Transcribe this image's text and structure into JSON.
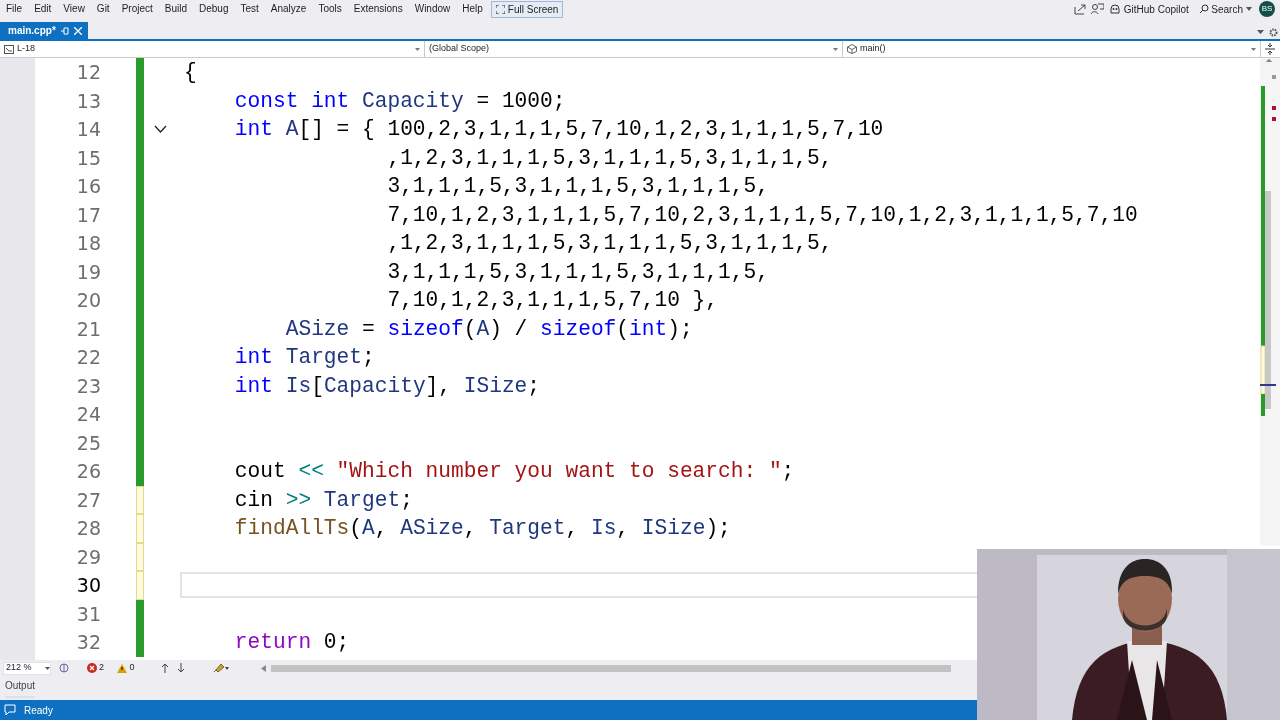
{
  "menu": [
    "File",
    "Edit",
    "View",
    "Git",
    "Project",
    "Build",
    "Debug",
    "Test",
    "Analyze",
    "Tools",
    "Extensions",
    "Window",
    "Help"
  ],
  "full_screen_button": "Full Screen",
  "copilot": "GitHub Copilot",
  "search": "Search",
  "avatar": "BS",
  "tabs": [
    {
      "label": "main.cpp*",
      "selected": true
    }
  ],
  "nav": {
    "project": "L-18",
    "scope": "(Global Scope)",
    "member": "main()"
  },
  "lines": [
    {
      "number": "12",
      "saved": true,
      "current": false,
      "fold": false,
      "tokens": [
        {
          "kind": "plain",
          "text": "{"
        }
      ]
    },
    {
      "number": "13",
      "saved": true,
      "current": false,
      "fold": false,
      "tokens": [
        {
          "kind": "kw",
          "text": "    const int "
        },
        {
          "kind": "var",
          "text": "Capacity"
        },
        {
          "kind": "plain",
          "text": " = 1000;"
        }
      ]
    },
    {
      "number": "14",
      "saved": true,
      "current": false,
      "fold": true,
      "tokens": [
        {
          "kind": "kw",
          "text": "    int "
        },
        {
          "kind": "var",
          "text": "A"
        },
        {
          "kind": "plain",
          "text": "[] = { 100,2,3,1,1,1,5,7,10,1,2,3,1,1,1,5,7,10"
        }
      ]
    },
    {
      "number": "15",
      "saved": true,
      "current": false,
      "fold": false,
      "tokens": [
        {
          "kind": "plain",
          "text": "                ,1,2,3,1,1,1,5,3,1,1,1,5,3,1,1,1,5,"
        }
      ]
    },
    {
      "number": "16",
      "saved": true,
      "current": false,
      "fold": false,
      "tokens": [
        {
          "kind": "plain",
          "text": "                3,1,1,1,5,3,1,1,1,5,3,1,1,1,5,"
        }
      ]
    },
    {
      "number": "17",
      "saved": true,
      "current": false,
      "fold": false,
      "tokens": [
        {
          "kind": "plain",
          "text": "                7,10,1,2,3,1,1,1,5,7,10,2,3,1,1,1,5,7,10,1,2,3,1,1,1,5,7,10"
        }
      ]
    },
    {
      "number": "18",
      "saved": true,
      "current": false,
      "fold": false,
      "tokens": [
        {
          "kind": "plain",
          "text": "                ,1,2,3,1,1,1,5,3,1,1,1,5,3,1,1,1,5,"
        }
      ]
    },
    {
      "number": "19",
      "saved": true,
      "current": false,
      "fold": false,
      "tokens": [
        {
          "kind": "plain",
          "text": "                3,1,1,1,5,3,1,1,1,5,3,1,1,1,5,"
        }
      ]
    },
    {
      "number": "20",
      "saved": true,
      "current": false,
      "fold": false,
      "tokens": [
        {
          "kind": "plain",
          "text": "                7,10,1,2,3,1,1,1,5,7,10 },"
        }
      ]
    },
    {
      "number": "21",
      "saved": true,
      "current": false,
      "fold": false,
      "tokens": [
        {
          "kind": "var",
          "text": "        ASize"
        },
        {
          "kind": "plain",
          "text": " = "
        },
        {
          "kind": "kw",
          "text": "sizeof"
        },
        {
          "kind": "plain",
          "text": "("
        },
        {
          "kind": "var",
          "text": "A"
        },
        {
          "kind": "plain",
          "text": ") / "
        },
        {
          "kind": "kw",
          "text": "sizeof"
        },
        {
          "kind": "plain",
          "text": "("
        },
        {
          "kind": "kw",
          "text": "int"
        },
        {
          "kind": "plain",
          "text": ");"
        }
      ]
    },
    {
      "number": "22",
      "saved": true,
      "current": false,
      "fold": false,
      "tokens": [
        {
          "kind": "kw",
          "text": "    int "
        },
        {
          "kind": "var",
          "text": "Target"
        },
        {
          "kind": "plain",
          "text": ";"
        }
      ]
    },
    {
      "number": "23",
      "saved": true,
      "current": false,
      "fold": false,
      "tokens": [
        {
          "kind": "kw",
          "text": "    int "
        },
        {
          "kind": "var",
          "text": "Is"
        },
        {
          "kind": "plain",
          "text": "["
        },
        {
          "kind": "var",
          "text": "Capacity"
        },
        {
          "kind": "plain",
          "text": "], "
        },
        {
          "kind": "var",
          "text": "ISize"
        },
        {
          "kind": "plain",
          "text": ";"
        }
      ]
    },
    {
      "number": "24",
      "saved": true,
      "current": false,
      "fold": false
    },
    {
      "number": "25",
      "saved": true,
      "current": false,
      "fold": false
    },
    {
      "number": "26",
      "saved": true,
      "current": false,
      "fold": false,
      "tokens": [
        {
          "kind": "plain",
          "text": "    cout "
        },
        {
          "kind": "op",
          "text": "<<"
        },
        {
          "kind": "str",
          "text": " \"Which number you want to search: \""
        },
        {
          "kind": "plain",
          "text": ";"
        }
      ]
    },
    {
      "number": "27",
      "saved": false,
      "current": false,
      "fold": false,
      "tokens": [
        {
          "kind": "plain",
          "text": "    cin "
        },
        {
          "kind": "op",
          "text": ">>"
        },
        {
          "kind": "var",
          "text": " Target"
        },
        {
          "kind": "plain",
          "text": ";"
        }
      ]
    },
    {
      "number": "28",
      "saved": false,
      "current": false,
      "fold": false,
      "tokens": [
        {
          "kind": "fn",
          "text": "    findAllTs"
        },
        {
          "kind": "plain",
          "text": "("
        },
        {
          "kind": "var",
          "text": "A"
        },
        {
          "kind": "plain",
          "text": ", "
        },
        {
          "kind": "var",
          "text": "ASize"
        },
        {
          "kind": "plain",
          "text": ", "
        },
        {
          "kind": "var",
          "text": "Target"
        },
        {
          "kind": "plain",
          "text": ", "
        },
        {
          "kind": "var",
          "text": "Is"
        },
        {
          "kind": "plain",
          "text": ", "
        },
        {
          "kind": "var",
          "text": "ISize"
        },
        {
          "kind": "plain",
          "text": ");"
        }
      ]
    },
    {
      "number": "29",
      "saved": false,
      "current": false,
      "fold": false
    },
    {
      "number": "30",
      "saved": false,
      "current": true,
      "fold": false
    },
    {
      "number": "31",
      "saved": true,
      "current": false,
      "fold": false
    },
    {
      "number": "32",
      "saved": true,
      "current": false,
      "fold": false,
      "tokens": [
        {
          "kind": "ctl",
          "text": "    return"
        },
        {
          "kind": "plain",
          "text": " 0;"
        }
      ]
    }
  ],
  "zoom": "212 %",
  "errors": "2",
  "warnings": "0",
  "output_tab": "Output",
  "status": "Ready"
}
